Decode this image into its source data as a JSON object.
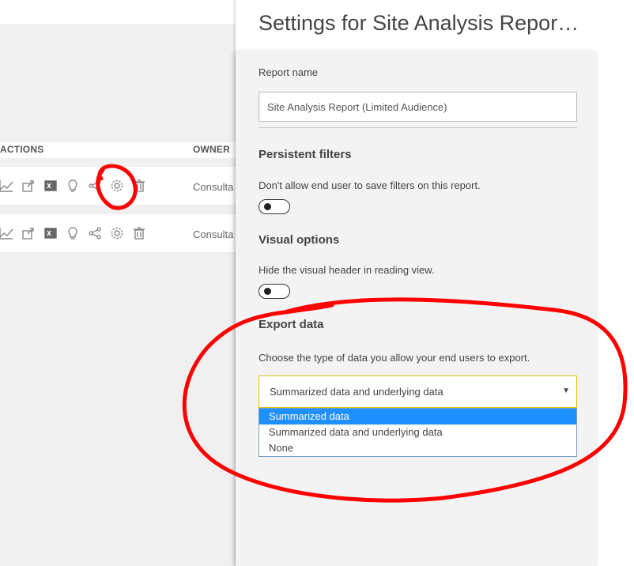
{
  "table": {
    "headers": {
      "actions": "ACTIONS",
      "owner": "OWNER"
    },
    "rows": [
      {
        "owner": "Consulta",
        "icons": [
          "trend-icon",
          "share-icon",
          "excel-icon",
          "lightbulb-icon",
          "share-nodes-icon",
          "gear-icon",
          "trash-icon"
        ]
      },
      {
        "owner": "Consulta",
        "icons": [
          "trend-icon",
          "share-icon",
          "excel-icon",
          "lightbulb-icon",
          "share-nodes-icon",
          "gear-icon",
          "trash-icon"
        ]
      }
    ]
  },
  "panel": {
    "title": "Settings for Site Analysis Repor…",
    "report_name_label": "Report name",
    "report_name_value": "Site Analysis Report (Limited Audience)",
    "persistent_filters": {
      "heading": "Persistent filters",
      "description": "Don't allow end user to save filters on this report."
    },
    "visual_options": {
      "heading": "Visual options",
      "description": "Hide the visual header in reading view."
    },
    "export_data": {
      "heading": "Export data",
      "description": "Choose the type of data you allow your end users to export.",
      "selected_value": "Summarized data and underlying data",
      "options": [
        "Summarized data",
        "Summarized data and underlying data",
        "None"
      ],
      "highlighted_option": "Summarized data"
    }
  },
  "colors": {
    "annotation": "#ff0000",
    "highlight": "#1e90ff",
    "focus_border": "#e6c200"
  }
}
